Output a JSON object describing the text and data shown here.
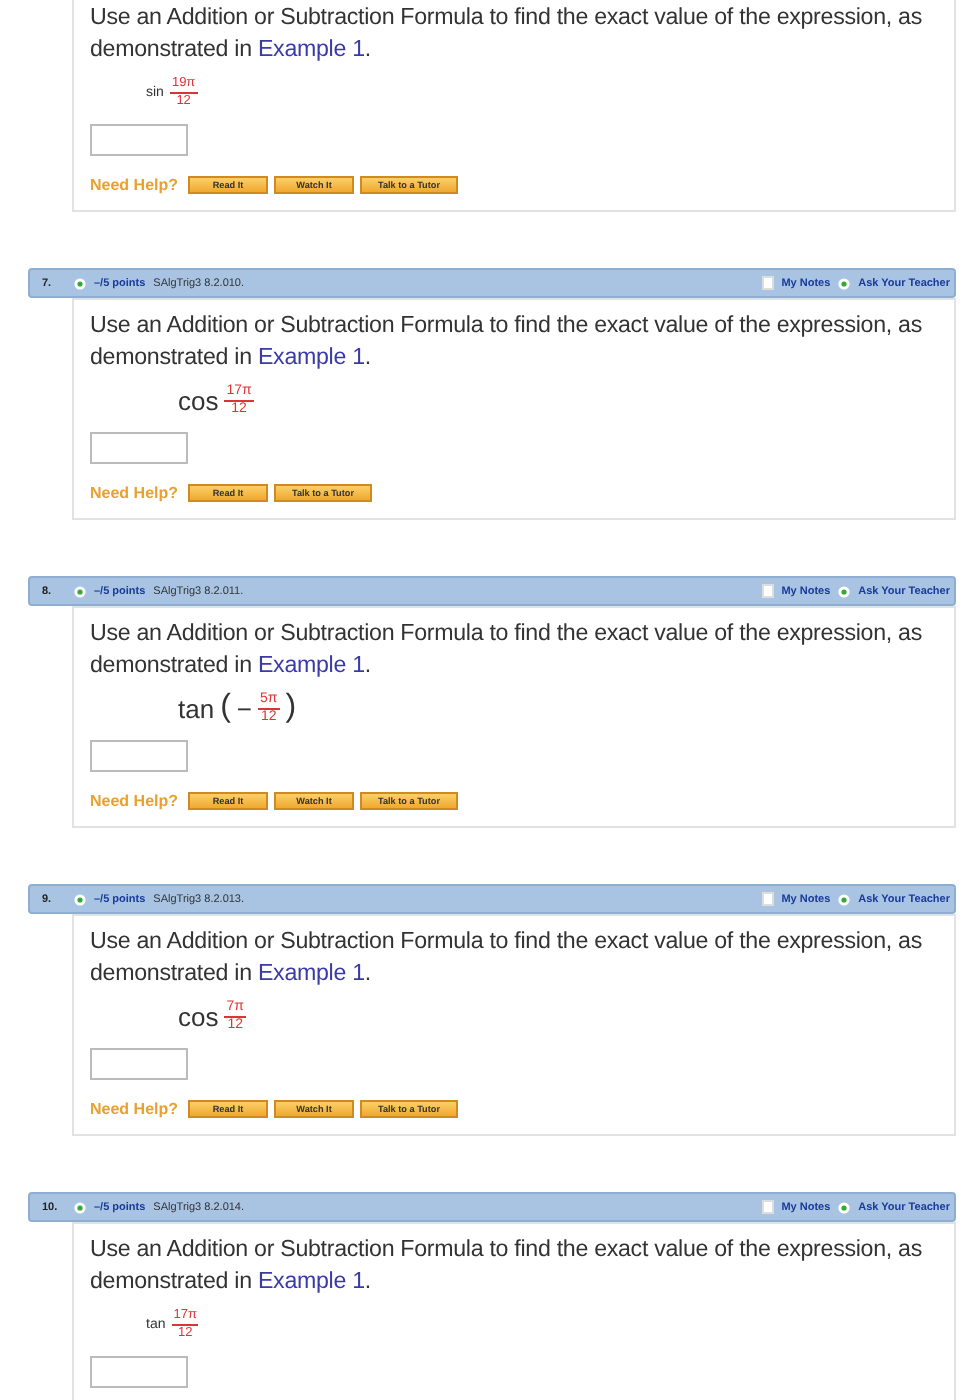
{
  "questions": [
    {
      "prompt": "Use an Addition or Subtraction Formula to find the exact value of the expression, as demonstrated in ",
      "link": "Example 1",
      "after": ".",
      "expression": {
        "kind": "small",
        "func": "sin",
        "numerator": "19π",
        "denominator": "12"
      },
      "help_label": "Need Help?",
      "buttons": [
        "Read It",
        "Watch It",
        "Talk to a Tutor"
      ]
    },
    {
      "header": {
        "number": "7.",
        "points": "–/5 points",
        "code": "SAlgTrig3 8.2.010.",
        "notes": "My Notes",
        "ask": "Ask Your Teacher"
      },
      "prompt": "Use an Addition or Subtraction Formula to find the exact value of the expression, as demonstrated in ",
      "link": "Example 1",
      "after": ".",
      "expression": {
        "kind": "large",
        "func": "cos",
        "numerator": "17π",
        "denominator": "12"
      },
      "help_label": "Need Help?",
      "buttons": [
        "Read It",
        "Talk to a Tutor"
      ]
    },
    {
      "header": {
        "number": "8.",
        "points": "–/5 points",
        "code": "SAlgTrig3 8.2.011.",
        "notes": "My Notes",
        "ask": "Ask Your Teacher"
      },
      "prompt": "Use an Addition or Subtraction Formula to find the exact value of the expression, as demonstrated in ",
      "link": "Example 1",
      "after": ".",
      "expression": {
        "kind": "large",
        "func": "tan",
        "open": "(",
        "sign": "−",
        "numerator": "5π",
        "denominator": "12",
        "close": ")"
      },
      "help_label": "Need Help?",
      "buttons": [
        "Read It",
        "Watch It",
        "Talk to a Tutor"
      ]
    },
    {
      "header": {
        "number": "9.",
        "points": "–/5 points",
        "code": "SAlgTrig3 8.2.013.",
        "notes": "My Notes",
        "ask": "Ask Your Teacher"
      },
      "prompt": "Use an Addition or Subtraction Formula to find the exact value of the expression, as demonstrated in ",
      "link": "Example 1",
      "after": ".",
      "expression": {
        "kind": "large",
        "func": "cos",
        "numerator": "7π",
        "denominator": "12"
      },
      "help_label": "Need Help?",
      "buttons": [
        "Read It",
        "Watch It",
        "Talk to a Tutor"
      ]
    },
    {
      "header": {
        "number": "10.",
        "points": "–/5 points",
        "code": "SAlgTrig3 8.2.014.",
        "notes": "My Notes",
        "ask": "Ask Your Teacher"
      },
      "prompt": "Use an Addition or Subtraction Formula to find the exact value of the expression, as demonstrated in ",
      "link": "Example 1",
      "after": ".",
      "expression": {
        "kind": "small",
        "func": "tan",
        "numerator": "17π",
        "denominator": "12"
      }
    }
  ]
}
